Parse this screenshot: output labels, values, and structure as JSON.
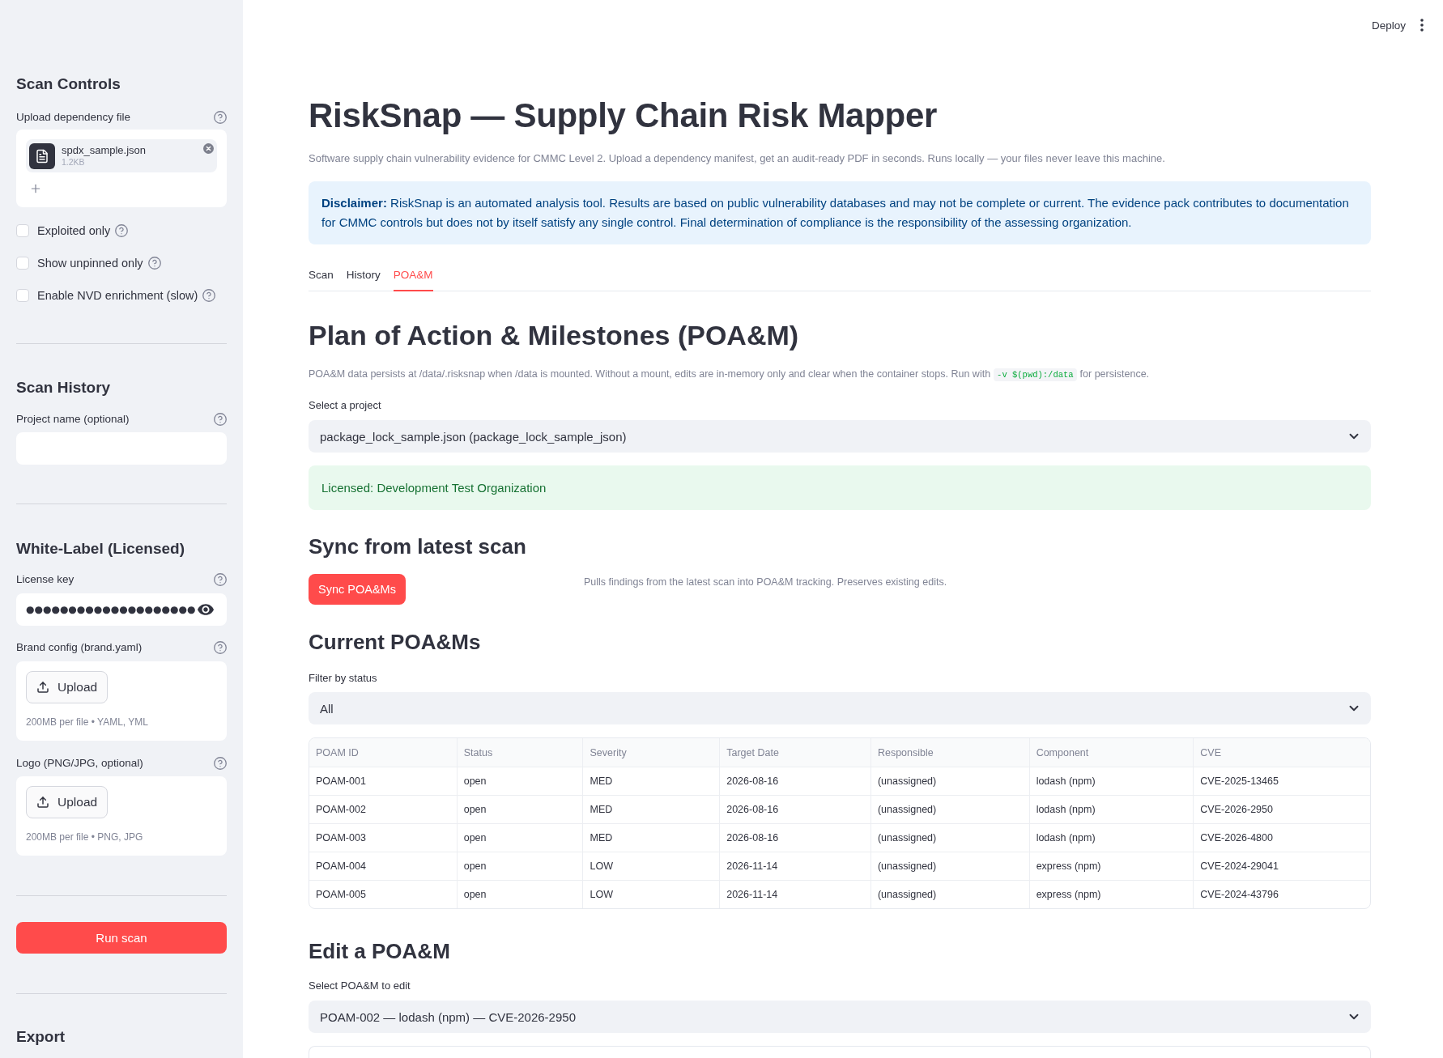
{
  "toolbar": {
    "deploy": "Deploy"
  },
  "sidebar": {
    "scan_controls": {
      "title": "Scan Controls",
      "uploader": {
        "label": "Upload dependency file",
        "file_name": "spdx_sample.json",
        "file_size": "1.2KB"
      },
      "checkboxes": [
        {
          "label": "Exploited only",
          "checked": false
        },
        {
          "label": "Show unpinned only",
          "checked": false
        },
        {
          "label": "Enable NVD enrichment (slow)",
          "checked": false
        }
      ]
    },
    "scan_history": {
      "title": "Scan History",
      "project_field": {
        "label": "Project name (optional)"
      }
    },
    "white_label": {
      "title": "White-Label (Licensed)",
      "license_field": {
        "label": "License key",
        "value": "●●●●●●●●●●●●●●●●●●●●"
      },
      "uploaders": [
        {
          "label": "Brand config (brand.yaml)",
          "button": "Upload",
          "caption": "200MB per file • YAML, YML"
        },
        {
          "label": "Logo (PNG/JPG, optional)",
          "button": "Upload",
          "caption": "200MB per file • PNG, JPG"
        }
      ]
    },
    "run_button": "Run scan",
    "export": {
      "title": "Export"
    }
  },
  "main": {
    "title": "RiskSnap — Supply Chain Risk Mapper",
    "subtitle": "Software supply chain vulnerability evidence for CMMC Level 2. Upload a dependency manifest, get an audit-ready PDF in seconds. Runs locally — your files never leave this machine.",
    "disclaimer": "**Disclaimer:** RiskSnap is an automated analysis tool. Results are based on public vulnerability databases and may not be complete or current. The evidence pack contributes to documentation for CMMC controls but does not by itself satisfy any single control. Final determination of compliance is the responsibility of the assessing organization.",
    "tabs": [
      {
        "label": "Scan",
        "selected": false
      },
      {
        "label": "History",
        "selected": false
      },
      {
        "label": "POA&M",
        "selected": true
      }
    ],
    "poam": {
      "heading": "Plan of Action & Milestones (POA&M)",
      "note": [
        {
          "kind": "text",
          "text": "POA&M data persists at /data/.risksnap when /data is mounted. Without a mount, edits are in-memory only and clear when the container stops. Run with"
        },
        {
          "kind": "code",
          "text": "-v $(pwd):/data"
        },
        {
          "kind": "text",
          "text": "for persistence."
        }
      ],
      "project_select": {
        "label": "Select a project",
        "value": "package_lock_sample.json (package_lock_sample_json)"
      },
      "license_notice": "Licensed: Development Test Organization",
      "sync": {
        "heading": "Sync from latest scan",
        "button": "Sync POA&Ms",
        "hint": "Pulls findings from the latest scan into POA&M tracking. Preserves existing edits."
      },
      "current": {
        "heading": "Current POA&Ms",
        "filter": {
          "label": "Filter by status",
          "value": "All"
        },
        "table": {
          "columns": [
            "POAM ID",
            "Status",
            "Severity",
            "Target Date",
            "Responsible",
            "Component",
            "CVE"
          ],
          "rows": [
            [
              "POAM-001",
              "open",
              "MED",
              "2026-08-16",
              "(unassigned)",
              "lodash (npm)",
              "CVE-2025-13465"
            ],
            [
              "POAM-002",
              "open",
              "MED",
              "2026-08-16",
              "(unassigned)",
              "lodash (npm)",
              "CVE-2026-2950"
            ],
            [
              "POAM-003",
              "open",
              "MED",
              "2026-08-16",
              "(unassigned)",
              "lodash (npm)",
              "CVE-2026-4800"
            ],
            [
              "POAM-004",
              "open",
              "LOW",
              "2026-11-14",
              "(unassigned)",
              "express (npm)",
              "CVE-2024-29041"
            ],
            [
              "POAM-005",
              "open",
              "LOW",
              "2026-11-14",
              "(unassigned)",
              "express (npm)",
              "CVE-2024-43796"
            ]
          ]
        }
      },
      "edit": {
        "heading": "Edit a POA&M",
        "select": {
          "label": "Select POA&M to edit",
          "value": "POAM-002 — lodash (npm) — CVE-2026-2950"
        }
      }
    }
  }
}
